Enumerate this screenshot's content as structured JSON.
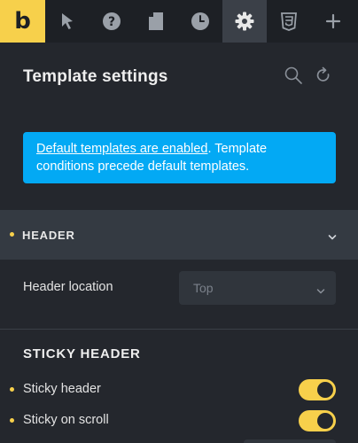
{
  "toolbar": {
    "logo_text": "b",
    "buttons": [
      {
        "icon": "cursor-icon"
      },
      {
        "icon": "help-icon"
      },
      {
        "icon": "page-icon"
      },
      {
        "icon": "history-icon"
      },
      {
        "icon": "gear-icon",
        "active": true
      },
      {
        "icon": "css3-icon"
      },
      {
        "icon": "plus-icon"
      }
    ]
  },
  "panel": {
    "title": "Template settings",
    "search_icon": "search-icon",
    "reset_icon": "reset-icon"
  },
  "notice": {
    "link_text": "Default templates are enabled",
    "rest_text": ". Template conditions precede default templates."
  },
  "header_section": {
    "label": "HEADER",
    "location_label": "Header location",
    "location_value": "Top"
  },
  "sticky_section": {
    "title": "STICKY HEADER",
    "rows": [
      {
        "label": "Sticky header",
        "enabled": true
      },
      {
        "label": "Sticky on scroll",
        "enabled": true
      }
    ]
  },
  "colors": {
    "accent": "#f7d04b",
    "info": "#03a9f4",
    "background": "#24272d",
    "toolbar": "#1d2025"
  }
}
